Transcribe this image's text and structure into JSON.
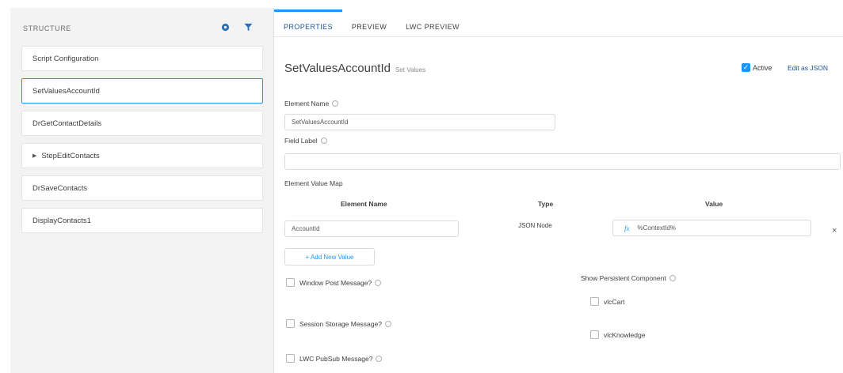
{
  "structure": {
    "title": "STRUCTURE",
    "items": [
      {
        "label": "Script Configuration",
        "selected": false,
        "expandable": false
      },
      {
        "label": "SetValuesAccountId",
        "selected": true,
        "expandable": false
      },
      {
        "label": "DrGetContactDetails",
        "selected": false,
        "expandable": false
      },
      {
        "label": "StepEditContacts",
        "selected": false,
        "expandable": true
      },
      {
        "label": "DrSaveContacts",
        "selected": false,
        "expandable": false
      },
      {
        "label": "DisplayContacts1",
        "selected": false,
        "expandable": false
      }
    ]
  },
  "tabs": [
    {
      "label": "PROPERTIES",
      "active": true
    },
    {
      "label": "PREVIEW",
      "active": false
    },
    {
      "label": "LWC PREVIEW",
      "active": false
    }
  ],
  "element": {
    "name": "SetValuesAccountId",
    "type": "Set Values",
    "active_label": "Active",
    "active_checked": true,
    "edit_json_label": "Edit as JSON"
  },
  "form": {
    "element_name_label": "Element Name",
    "element_name_value": "SetValuesAccountId",
    "field_label_label": "Field Label",
    "field_label_value": "",
    "value_map_label": "Element Value Map",
    "columns": {
      "name": "Element Name",
      "type": "Type",
      "value": "Value"
    },
    "rows": [
      {
        "name": "AccountId",
        "type": "JSON Node",
        "value": "%ContextId%"
      }
    ],
    "add_value_label": "+ Add New Value",
    "fx_glyph": "fx",
    "delete_glyph": "×"
  },
  "options": {
    "window_post": "Window Post Message?",
    "session_storage": "Session Storage Message?",
    "lwc_pubsub": "LWC PubSub Message?",
    "persistent_label": "Show Persistent Component",
    "vlc_cart": "vlcCart",
    "vlc_knowledge": "vlcKnowledge"
  },
  "colors": {
    "accent": "#1b96ff",
    "panel_bg": "#f3f3f3"
  }
}
